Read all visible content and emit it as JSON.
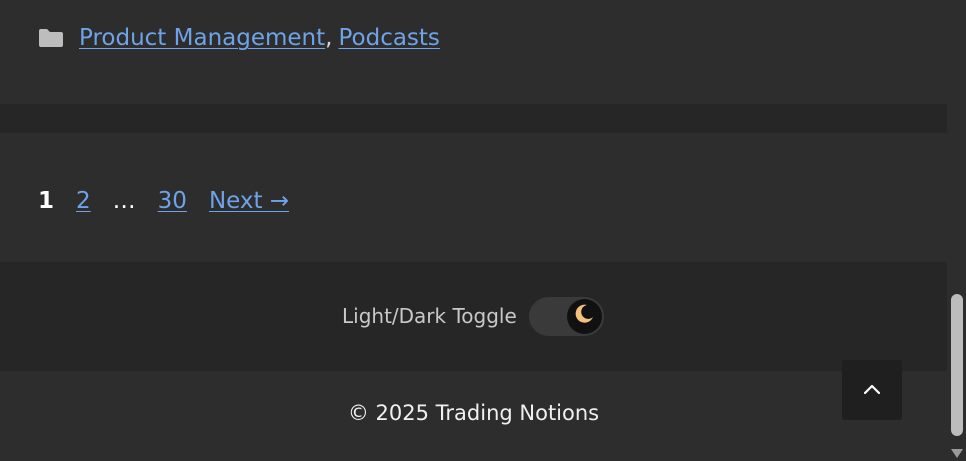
{
  "post_meta": {
    "categories": [
      {
        "label": "Product Management"
      },
      {
        "label": "Podcasts"
      }
    ],
    "separator": ","
  },
  "pagination": {
    "current": "1",
    "page_2": "2",
    "ellipsis": "…",
    "last_page": "30",
    "next_label": "Next →"
  },
  "footer": {
    "toggle_label": "Light/Dark Toggle",
    "copyright": "© 2025 Trading Notions"
  },
  "icons": {
    "category": "folder-icon",
    "toggle": "moon-icon",
    "back_to_top": "chevron-up-icon"
  },
  "colors": {
    "background": "#2d2d2d",
    "band": "#262626",
    "link": "#6ea3e8",
    "moon": "#f5c07a"
  }
}
